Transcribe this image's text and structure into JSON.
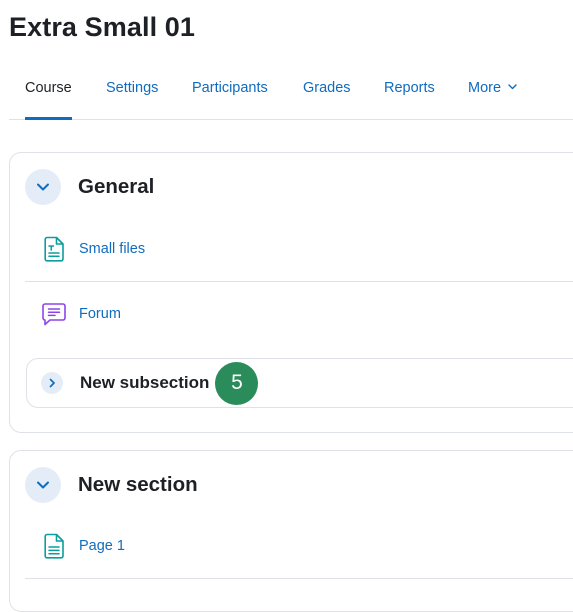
{
  "page": {
    "title": "Extra Small 01"
  },
  "nav": {
    "tabs": [
      {
        "label": "Course",
        "active": true
      },
      {
        "label": "Settings"
      },
      {
        "label": "Participants"
      },
      {
        "label": "Grades"
      },
      {
        "label": "Reports"
      },
      {
        "label": "More"
      }
    ]
  },
  "sections": [
    {
      "title": "General",
      "toggle_icon": "chevron-down-icon",
      "activities": [
        {
          "label": "Small files",
          "icon": "file-icon",
          "icon_color": "#0a9e9e"
        },
        {
          "label": "Forum",
          "icon": "forum-icon",
          "icon_color": "#8c45e8"
        }
      ],
      "subsection": {
        "title": "New subsection",
        "toggle_icon": "chevron-right-icon",
        "badge": "5"
      }
    },
    {
      "title": "New section",
      "toggle_icon": "chevron-down-icon",
      "activities": [
        {
          "label": "Page 1",
          "icon": "page-icon",
          "icon_color": "#0a9e9e"
        }
      ]
    }
  ],
  "colors": {
    "link": "#0f6cbf",
    "toggle_bg": "#e4edf7",
    "badge_bg": "#2a8c5a",
    "border": "#dee2e6"
  }
}
